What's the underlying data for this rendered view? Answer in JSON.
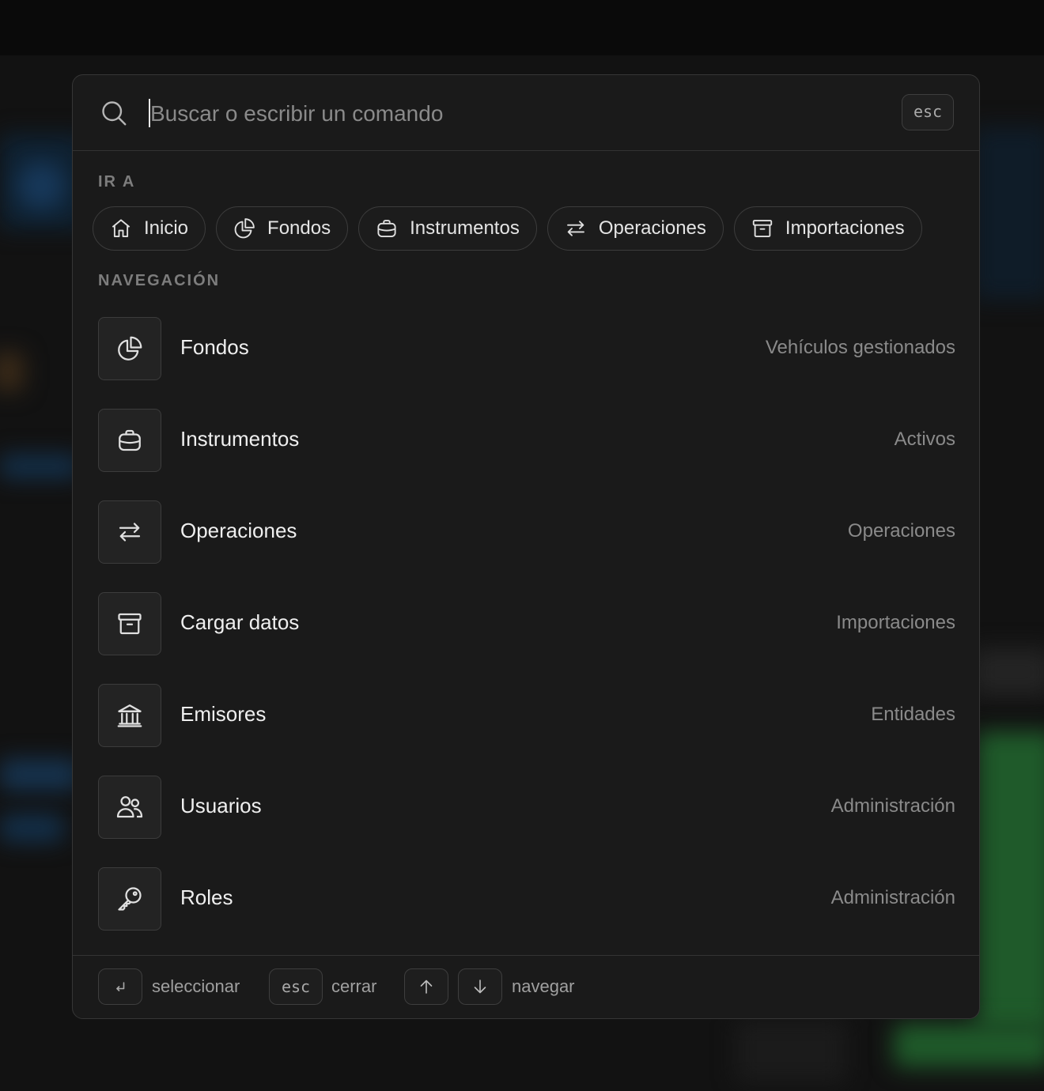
{
  "search": {
    "placeholder": "Buscar o escribir un comando",
    "esc_label": "esc"
  },
  "sections": {
    "go_to": "IR A",
    "navigation": "NAVEGACIÓN"
  },
  "quick_links": [
    {
      "label": "Inicio",
      "icon": "home-icon"
    },
    {
      "label": "Fondos",
      "icon": "pie-chart-icon"
    },
    {
      "label": "Instrumentos",
      "icon": "briefcase-icon"
    },
    {
      "label": "Operaciones",
      "icon": "arrows-exchange-icon"
    },
    {
      "label": "Importaciones",
      "icon": "archive-icon"
    }
  ],
  "nav_items": [
    {
      "label": "Fondos",
      "description": "Vehículos gestionados",
      "icon": "pie-chart-icon"
    },
    {
      "label": "Instrumentos",
      "description": "Activos",
      "icon": "briefcase-icon"
    },
    {
      "label": "Operaciones",
      "description": "Operaciones",
      "icon": "arrows-exchange-icon"
    },
    {
      "label": "Cargar datos",
      "description": "Importaciones",
      "icon": "archive-icon"
    },
    {
      "label": "Emisores",
      "description": "Entidades",
      "icon": "bank-icon"
    },
    {
      "label": "Usuarios",
      "description": "Administración",
      "icon": "users-icon"
    },
    {
      "label": "Roles",
      "description": "Administración",
      "icon": "key-icon"
    }
  ],
  "footer": {
    "enter_hint": "seleccionar",
    "esc_key": "esc",
    "esc_hint": "cerrar",
    "nav_hint": "navegar"
  }
}
